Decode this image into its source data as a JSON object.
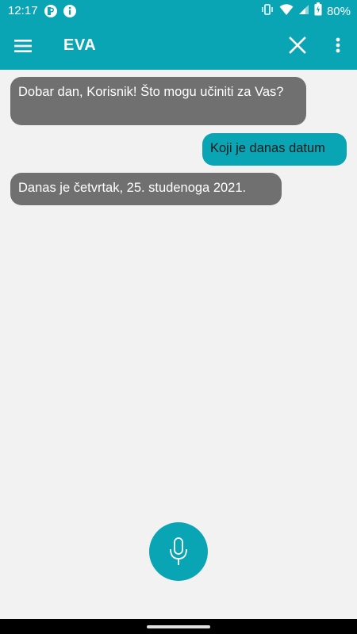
{
  "status_bar": {
    "time": "12:17",
    "battery": "80%",
    "icons_left": [
      "pocket-icon",
      "info-icon"
    ],
    "icons_right": [
      "vibrate-icon",
      "wifi-icon",
      "signal-icon",
      "battery-icon"
    ]
  },
  "app_bar": {
    "title": "EVA",
    "color": "#0aa5b4"
  },
  "messages": [
    {
      "sender": "bot",
      "text": "Dobar dan, Korisnik! Što mogu učiniti za Vas?"
    },
    {
      "sender": "user",
      "text": "Koji je danas datum"
    },
    {
      "sender": "bot",
      "text": "Danas je četvrtak, 25. studenoga 2021."
    }
  ],
  "colors": {
    "accent": "#0aa5b4",
    "bot_bubble": "#707070",
    "background": "#f2f2f2"
  }
}
